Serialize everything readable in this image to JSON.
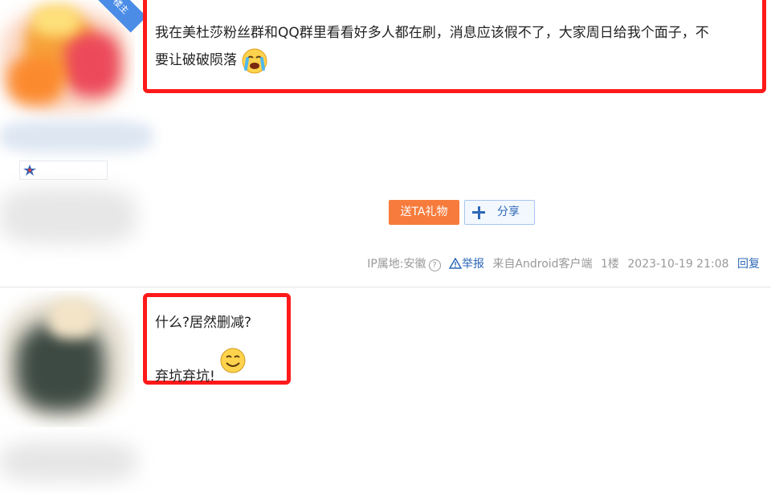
{
  "post1": {
    "author_badge": "楼主",
    "content_line1": "我在美杜莎粉丝群和QQ群里看看好多人都在刷，消息应该假不了，大家周日给我个面子，不",
    "content_line2": "要让破破陨落",
    "emoji": "crying-face-emoji",
    "gift_button": "送TA礼物",
    "share_button": "分享",
    "meta": {
      "ip_location": "IP属地:安徽",
      "help_icon": "?",
      "report": "举报",
      "client": "来自Android客户端",
      "floor": "1楼",
      "timestamp": "2023-10-19 21:08",
      "reply": "回复"
    }
  },
  "post2": {
    "content_line1": "什么?居然删减?",
    "content_line2": "弃坑弃坑!",
    "emoji": "smiling-face-emoji"
  },
  "colors": {
    "highlight_red": "#ff1a1a",
    "gift_orange": "#f77b3c",
    "link_blue": "#2c68b7",
    "meta_gray": "#999999"
  }
}
